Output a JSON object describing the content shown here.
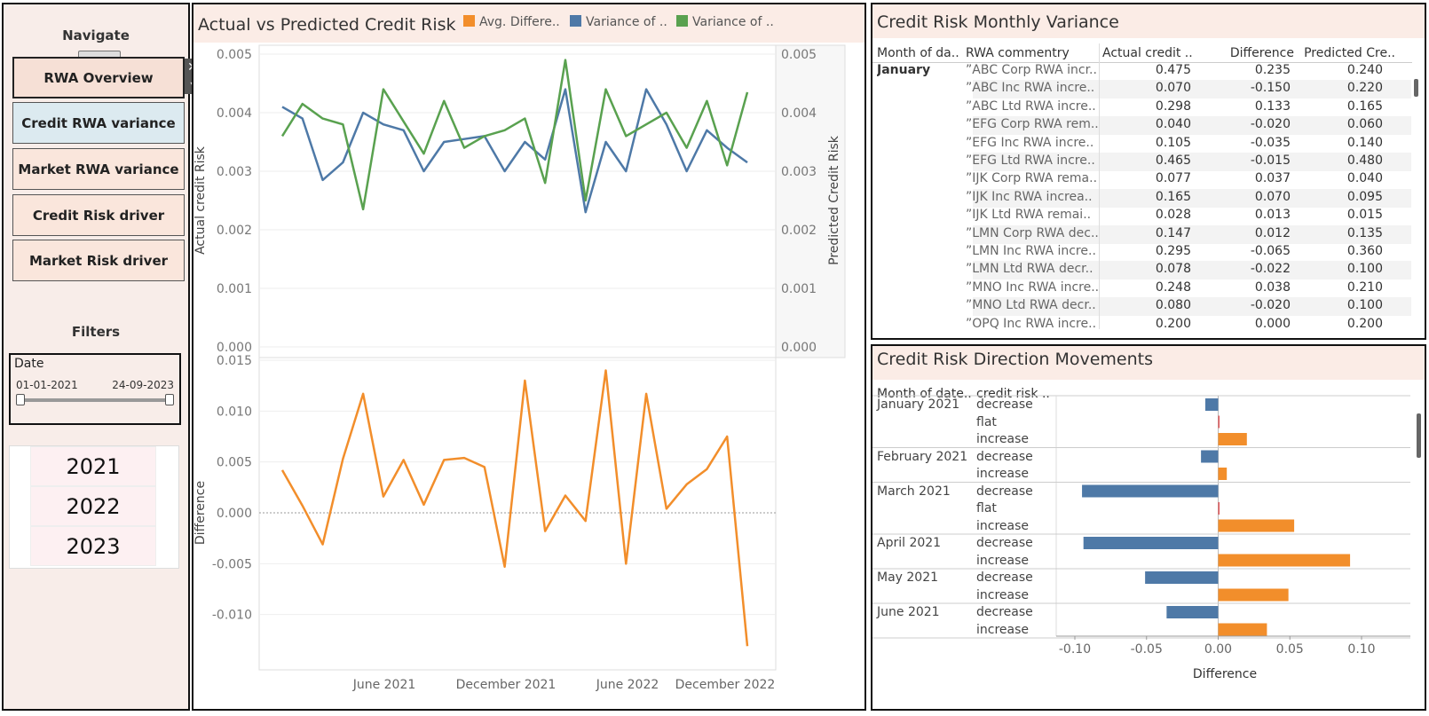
{
  "nav": {
    "title": "Navigate",
    "close_glyph": "✕",
    "dropdown_glyph": "▾",
    "buttons": [
      "RWA Overview",
      "Credit RWA variance",
      "Market RWA variance",
      "Credit Risk driver",
      "Market Risk driver"
    ]
  },
  "filters": {
    "title": "Filters",
    "date_label": "Date",
    "date_start": "01-01-2021",
    "date_end": "24-09-2023",
    "years": [
      "2021",
      "2022",
      "2023"
    ]
  },
  "colors": {
    "orange": "#f28e2b",
    "blue": "#4e79a7",
    "green": "#59a14f",
    "header_bg": "#fbece6"
  },
  "chart_data": [
    {
      "type": "line",
      "title": "Actual vs Predicted Credit Risk",
      "legend": [
        "Avg. Differe..",
        "Variance of ..",
        "Variance of .."
      ],
      "ylabel_left": "Actual credit Risk",
      "ylabel_right": "Predicted Credit Risk",
      "ylim": [
        0,
        0.005
      ],
      "y_ticks": [
        "0.000",
        "0.001",
        "0.002",
        "0.003",
        "0.004",
        "0.005"
      ],
      "series": [
        {
          "name": "Variance of ..",
          "color": "#4e79a7",
          "values": [
            0.0041,
            0.0039,
            0.00285,
            0.00315,
            0.004,
            0.0038,
            0.0037,
            0.003,
            0.0035,
            0.00355,
            0.0036,
            0.003,
            0.0035,
            0.0032,
            0.0044,
            0.0023,
            0.0035,
            0.003,
            0.0044,
            0.0038,
            0.003,
            0.0037,
            0.0034,
            0.00315
          ]
        },
        {
          "name": "Variance of ..",
          "color": "#59a14f",
          "values": [
            0.0036,
            0.00415,
            0.0039,
            0.0038,
            0.00235,
            0.0044,
            0.00385,
            0.0033,
            0.0042,
            0.0034,
            0.0036,
            0.0037,
            0.0039,
            0.0028,
            0.0049,
            0.0025,
            0.0044,
            0.0036,
            0.0038,
            0.004,
            0.0034,
            0.0042,
            0.0031,
            0.00435
          ]
        }
      ]
    },
    {
      "type": "line",
      "title": "",
      "ylabel": "Difference",
      "ylim": [
        -0.013,
        0.015
      ],
      "y_ticks": [
        "-0.010",
        "-0.005",
        "0.000",
        "0.005",
        "0.010",
        "0.015"
      ],
      "x_ticks": [
        "June 2021",
        "December 2021",
        "June 2022",
        "December 2022"
      ],
      "series": [
        {
          "name": "Avg. Differe..",
          "color": "#f28e2b",
          "values": [
            0.0042,
            0.0007,
            -0.0031,
            0.0053,
            0.0117,
            0.0016,
            0.0052,
            0.0008,
            0.0052,
            0.0054,
            0.0045,
            -0.0053,
            0.013,
            -0.0018,
            0.0017,
            -0.0008,
            0.014,
            -0.005,
            0.0117,
            0.0004,
            0.0028,
            0.0043,
            0.0075,
            -0.0131
          ]
        }
      ]
    },
    {
      "type": "table",
      "title": "Credit Risk Monthly Variance",
      "columns": [
        "Month of da..",
        "RWA commentry",
        "Actual credit ..",
        "Difference",
        "Predicted Cre.."
      ],
      "month": "January",
      "rows": [
        [
          "”ABC Corp RWA incr..",
          "0.475",
          "0.235",
          "0.240"
        ],
        [
          "”ABC Inc RWA incre..",
          "0.070",
          "-0.150",
          "0.220"
        ],
        [
          "”ABC Ltd RWA incre..",
          "0.298",
          "0.133",
          "0.165"
        ],
        [
          "”EFG Corp RWA rem..",
          "0.040",
          "-0.020",
          "0.060"
        ],
        [
          "”EFG Inc RWA incre..",
          "0.105",
          "-0.035",
          "0.140"
        ],
        [
          "”EFG Ltd RWA incre..",
          "0.465",
          "-0.015",
          "0.480"
        ],
        [
          "”IJK Corp RWA rema..",
          "0.077",
          "0.037",
          "0.040"
        ],
        [
          "”IJK Inc RWA increa..",
          "0.165",
          "0.070",
          "0.095"
        ],
        [
          "”IJK Ltd RWA remai..",
          "0.028",
          "0.013",
          "0.015"
        ],
        [
          "”LMN Corp RWA dec..",
          "0.147",
          "0.012",
          "0.135"
        ],
        [
          "”LMN Inc RWA incre..",
          "0.295",
          "-0.065",
          "0.360"
        ],
        [
          "”LMN Ltd RWA decr..",
          "0.078",
          "-0.022",
          "0.100"
        ],
        [
          "”MNO Inc RWA incre..",
          "0.248",
          "0.038",
          "0.210"
        ],
        [
          "”MNO Ltd RWA decr..",
          "0.080",
          "-0.020",
          "0.100"
        ],
        [
          "”OPQ Inc RWA incre..",
          "0.200",
          "0.000",
          "0.200"
        ]
      ]
    },
    {
      "type": "bar",
      "title": "Credit Risk Direction Movements",
      "columns": [
        "Month of date..",
        "credit risk .."
      ],
      "xlabel": "Difference",
      "xlim": [
        -0.12,
        0.12
      ],
      "x_ticks": [
        "-0.10",
        "-0.05",
        "0.00",
        "0.05",
        "0.10"
      ],
      "groups": [
        {
          "month": "January 2021",
          "rows": [
            {
              "label": "decrease",
              "value": -0.009
            },
            {
              "label": "flat",
              "value": 0.0
            },
            {
              "label": "increase",
              "value": 0.02
            }
          ]
        },
        {
          "month": "February 2021",
          "rows": [
            {
              "label": "decrease",
              "value": -0.012
            },
            {
              "label": "increase",
              "value": 0.006
            }
          ]
        },
        {
          "month": "March 2021",
          "rows": [
            {
              "label": "decrease",
              "value": -0.095
            },
            {
              "label": "flat",
              "value": 0.0
            },
            {
              "label": "increase",
              "value": 0.053
            }
          ]
        },
        {
          "month": "April 2021",
          "rows": [
            {
              "label": "decrease",
              "value": -0.094
            },
            {
              "label": "increase",
              "value": 0.092
            }
          ]
        },
        {
          "month": "May 2021",
          "rows": [
            {
              "label": "decrease",
              "value": -0.051
            },
            {
              "label": "increase",
              "value": 0.049
            }
          ]
        },
        {
          "month": "June 2021",
          "rows": [
            {
              "label": "decrease",
              "value": -0.036
            },
            {
              "label": "increase",
              "value": 0.034
            }
          ]
        }
      ]
    }
  ]
}
